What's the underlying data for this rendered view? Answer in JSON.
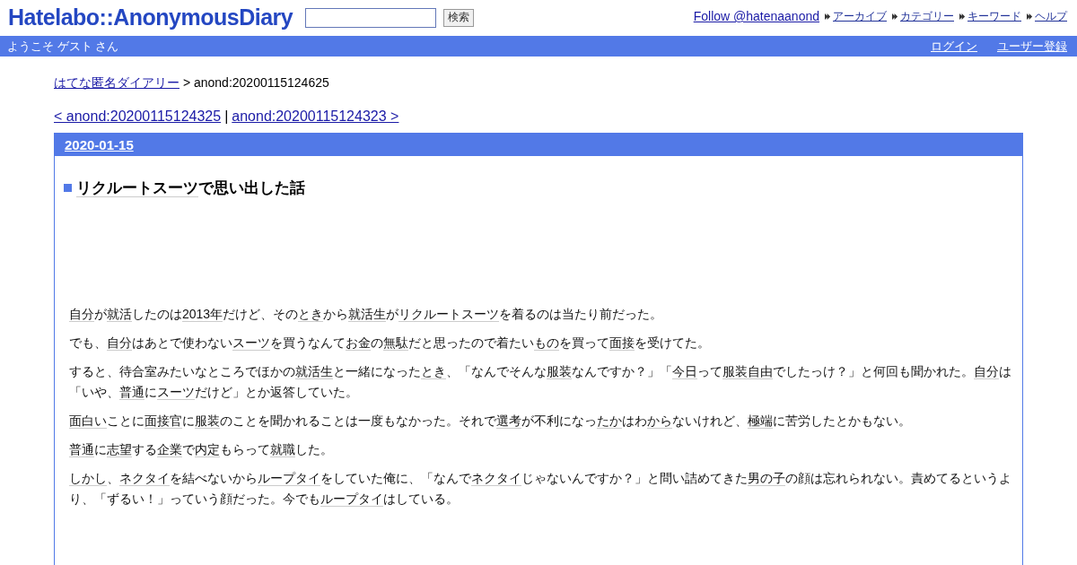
{
  "header": {
    "logo": "Hatelabo::AnonymousDiary",
    "search": {
      "button": "検索"
    },
    "follow_link": "Follow @hatenaanond",
    "nav_links": [
      "アーカイブ",
      "カテゴリー",
      "キーワード",
      "ヘルプ"
    ]
  },
  "user_bar": {
    "greeting": "ようこそ ゲスト さん",
    "links": [
      "ログイン",
      "ユーザー登録"
    ]
  },
  "breadcrumb": {
    "link": "はてな匿名ダイアリー",
    "current": "> anond:20200115124625"
  },
  "pager": {
    "prev": "< anond:20200115124325",
    "separator": "|",
    "next": "anond:20200115124323 >"
  },
  "entry": {
    "date": "2020-01-15",
    "title": [
      {
        "text": "リクルートスーツ",
        "keyword": true
      },
      {
        "text": "で思い出した話",
        "keyword": false
      }
    ],
    "paragraphs": [
      [
        {
          "text": "自分",
          "keyword": true
        },
        {
          "text": "が",
          "keyword": false
        },
        {
          "text": "就活",
          "keyword": true
        },
        {
          "text": "したのは",
          "keyword": false
        },
        {
          "text": "2013年",
          "keyword": true
        },
        {
          "text": "だけど、その",
          "keyword": false
        },
        {
          "text": "とき",
          "keyword": true
        },
        {
          "text": "から",
          "keyword": false
        },
        {
          "text": "就活生",
          "keyword": true
        },
        {
          "text": "が",
          "keyword": false
        },
        {
          "text": "リクルートスーツ",
          "keyword": true
        },
        {
          "text": "を着るのは当たり前だった。",
          "keyword": false
        }
      ],
      [
        {
          "text": "でも、",
          "keyword": false
        },
        {
          "text": "自分",
          "keyword": true
        },
        {
          "text": "はあとで使わない",
          "keyword": false
        },
        {
          "text": "スーツ",
          "keyword": true
        },
        {
          "text": "を買うなんて",
          "keyword": false
        },
        {
          "text": "お金",
          "keyword": true
        },
        {
          "text": "の",
          "keyword": false
        },
        {
          "text": "無駄",
          "keyword": true
        },
        {
          "text": "だと思ったので着たい",
          "keyword": false
        },
        {
          "text": "もの",
          "keyword": true
        },
        {
          "text": "を買って",
          "keyword": false
        },
        {
          "text": "面接",
          "keyword": true
        },
        {
          "text": "を受けてた。",
          "keyword": false
        }
      ],
      [
        {
          "text": "すると、待合室みたいなところでほかの",
          "keyword": false
        },
        {
          "text": "就活生",
          "keyword": true
        },
        {
          "text": "と一緒になった",
          "keyword": false
        },
        {
          "text": "とき",
          "keyword": true
        },
        {
          "text": "、「なんでそんな",
          "keyword": false
        },
        {
          "text": "服装",
          "keyword": true
        },
        {
          "text": "なんですか？」「",
          "keyword": false
        },
        {
          "text": "今日",
          "keyword": true
        },
        {
          "text": "って",
          "keyword": false
        },
        {
          "text": "服装自由",
          "keyword": true
        },
        {
          "text": "でしたっけ？」と何回も聞かれた。",
          "keyword": false
        },
        {
          "text": "自分",
          "keyword": true
        },
        {
          "text": "は「いや、",
          "keyword": false
        },
        {
          "text": "普通",
          "keyword": true
        },
        {
          "text": "に",
          "keyword": false
        },
        {
          "text": "スーツ",
          "keyword": true
        },
        {
          "text": "だけど」とか返答していた。",
          "keyword": false
        }
      ],
      [
        {
          "text": "面白い",
          "keyword": true
        },
        {
          "text": "ことに",
          "keyword": false
        },
        {
          "text": "面接官",
          "keyword": true
        },
        {
          "text": "に",
          "keyword": false
        },
        {
          "text": "服装",
          "keyword": true
        },
        {
          "text": "のことを聞かれることは一度もなかった。それで",
          "keyword": false
        },
        {
          "text": "選考",
          "keyword": true
        },
        {
          "text": "が不利になっ",
          "keyword": false
        },
        {
          "text": "たか",
          "keyword": true
        },
        {
          "text": "はわ",
          "keyword": false
        },
        {
          "text": "から",
          "keyword": true
        },
        {
          "text": "ないけれど、",
          "keyword": false
        },
        {
          "text": "極端",
          "keyword": true
        },
        {
          "text": "に苦労したとかもない。",
          "keyword": false
        }
      ],
      [
        {
          "text": "普通",
          "keyword": true
        },
        {
          "text": "に",
          "keyword": false
        },
        {
          "text": "志望",
          "keyword": true
        },
        {
          "text": "する",
          "keyword": false
        },
        {
          "text": "企業",
          "keyword": true
        },
        {
          "text": "で",
          "keyword": false
        },
        {
          "text": "内定",
          "keyword": true
        },
        {
          "text": "もらって",
          "keyword": false
        },
        {
          "text": "就職",
          "keyword": true
        },
        {
          "text": "した。",
          "keyword": false
        }
      ],
      [
        {
          "text": "しかし",
          "keyword": true
        },
        {
          "text": "、",
          "keyword": false
        },
        {
          "text": "ネクタイ",
          "keyword": true
        },
        {
          "text": "を結べないから",
          "keyword": false
        },
        {
          "text": "ループタイ",
          "keyword": true
        },
        {
          "text": "をしていた俺に、「なんで",
          "keyword": false
        },
        {
          "text": "ネクタイ",
          "keyword": true
        },
        {
          "text": "じゃないんですか？」と問い詰めてきた",
          "keyword": false
        },
        {
          "text": "男の子",
          "keyword": true
        },
        {
          "text": "の顔は忘れられない。責めてるというより、「ずるい！」っていう顔だった。今でも",
          "keyword": false
        },
        {
          "text": "ループタイ",
          "keyword": true
        },
        {
          "text": "はしている。",
          "keyword": false
        }
      ]
    ]
  }
}
